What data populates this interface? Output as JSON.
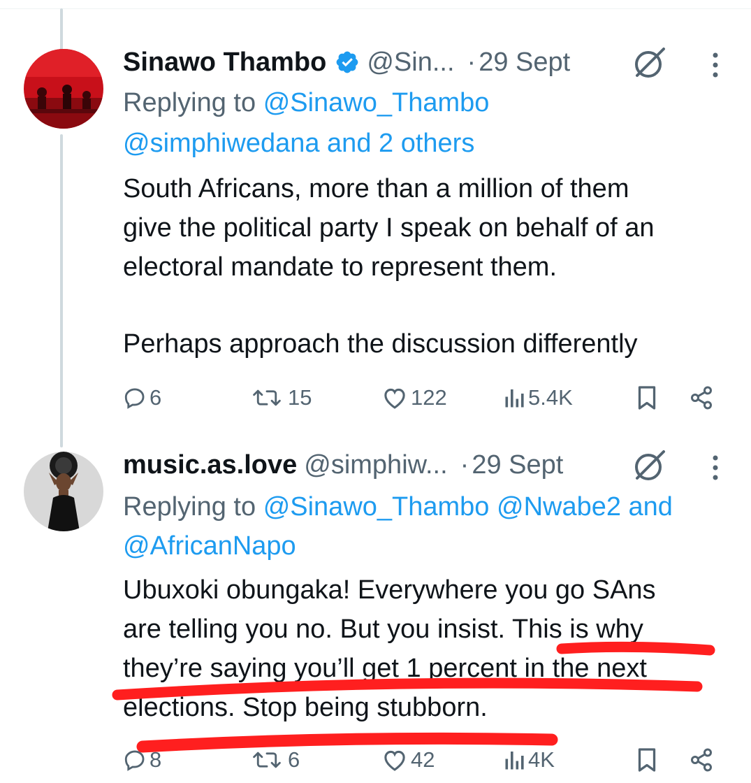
{
  "tweets": [
    {
      "name": "Sinawo Thambo",
      "verified": true,
      "handle": "@Sin...",
      "separator": "·",
      "date": "29 Sept",
      "replying_prefix": "Replying to",
      "replying_mention_1": "@Sinawo_Thambo",
      "replying_mention_2": "@simphiwedana and 2 others",
      "body": [
        "South Africans, more than a million of them",
        "give the political party I speak on behalf of an",
        "electoral mandate to represent them.",
        "Perhaps approach the discussion differently"
      ],
      "stats": {
        "replies": "6",
        "reposts": "15",
        "likes": "122",
        "views": "5.4K"
      }
    },
    {
      "name": "music.as.love",
      "verified": false,
      "handle": "@simphiw...",
      "separator": "·",
      "date": "29 Sept",
      "replying_prefix": "Replying to",
      "replying_mention_1": "@Sinawo_Thambo @Nwabe2 and",
      "replying_mention_2": "@AfricanNapo",
      "body": [
        "Ubuxoki obungaka! Everywhere you go SAns",
        "are telling you no. But you insist. This is why",
        "they’re saying you’ll get 1 percent in the next",
        "elections. Stop being stubborn."
      ],
      "stats": {
        "replies": "8",
        "reposts": "6",
        "likes": "42",
        "views": "4K"
      }
    }
  ],
  "colors": {
    "accent": "#1d9bf0",
    "secondary_text": "#536471",
    "annotation": "#ff1f1f",
    "thread_line": "#cfd9de"
  },
  "icons": [
    "verified-badge-icon",
    "grok-icon",
    "more-options-icon",
    "reply-icon",
    "repost-icon",
    "like-icon",
    "views-icon",
    "bookmark-icon",
    "share-icon"
  ]
}
